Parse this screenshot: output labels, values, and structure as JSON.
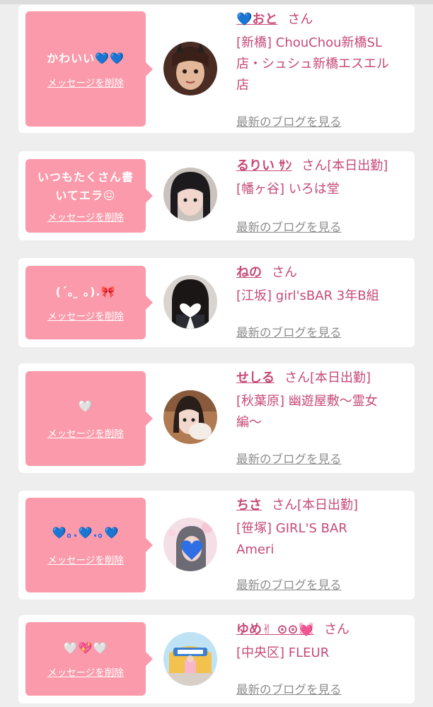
{
  "delete_label": "メッセージを削除",
  "blog_label": "最新のブログを見る",
  "colors": {
    "bubble": "#fb9aaa",
    "name": "#c64a78",
    "link_gray": "#8c8c8c",
    "card": "#ffffff",
    "background": "#eeeeee"
  },
  "entries": [
    {
      "message_lines": [
        "かわいい💙💙"
      ],
      "name": "💙おと",
      "honorific": "さん",
      "status": "",
      "shop_lines": [
        "[新橋] ChouChou新橋SL",
        "店・シュシュ新橋エスエル",
        "店"
      ]
    },
    {
      "message_lines": [
        "いつもたくさん書",
        "いてエラ😖"
      ],
      "name": "るりい ｻﾝ",
      "honorific": "さん",
      "status": "[本日出勤]",
      "shop_lines": [
        "[幡ヶ谷] いろは堂"
      ]
    },
    {
      "message_lines": [
        "(´｡ ̫ ｡).🎀"
      ],
      "name": "ねの",
      "honorific": "さん",
      "status": "",
      "shop_lines": [
        "[江坂] girl'sBAR 3年B組"
      ]
    },
    {
      "message_lines": [
        "🤍"
      ],
      "name": "せしる",
      "honorific": "さん",
      "status": "[本日出勤]",
      "shop_lines": [
        "[秋葉原] 幽遊屋敷〜霊女",
        "編〜"
      ]
    },
    {
      "message_lines": [
        "💙｡.💙.｡💙"
      ],
      "name": "ちさ",
      "honorific": "さん",
      "status": "[本日出勤]",
      "shop_lines": [
        "[笹塚] GIRL'S BAR",
        "Ameri"
      ]
    },
    {
      "message_lines": [
        "🤍💖🤍"
      ],
      "name": "ゆめ✌︎ ⊙⊙💓",
      "honorific": "さん",
      "status": "",
      "shop_lines": [
        "[中央区] FLEUR"
      ]
    }
  ]
}
